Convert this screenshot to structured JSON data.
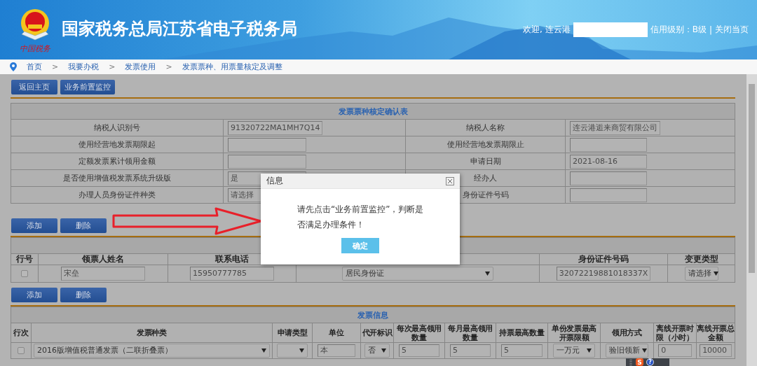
{
  "header": {
    "title": "国家税务总局江苏省电子税务局",
    "emblem_caption": "中国税务",
    "welcome": "欢迎, 连云港",
    "credit": "信用级别：B级",
    "separator": "|",
    "close": "关闭当页"
  },
  "breadcrumb": [
    "首页",
    "我要办税",
    "发票使用",
    "发票票种、用票量核定及调整"
  ],
  "breadcrumb_separator": ">",
  "top_buttons": [
    "返回主页",
    "业务前置监控"
  ],
  "confirm_form": {
    "title": "发票票种核定确认表",
    "rows": [
      {
        "label": "纳税人识别号",
        "value": "91320722MA1MH7Q14",
        "label_2": "纳税人名称",
        "value_2": "连云港逅来商贸有限公司"
      },
      {
        "label": "使用经营地发票期限起",
        "label_2": "使用经营地发票期限止"
      },
      {
        "label": "定额发票累计领用金额",
        "label_2": "申请日期",
        "value_2": "2021-08-16"
      },
      {
        "label": "是否使用增值税发票系统升级版",
        "value": "是",
        "label_2": "经办人"
      },
      {
        "label": "办理人员身份证件种类",
        "value": "请选择",
        "label_2": "身份证件号码"
      }
    ]
  },
  "applicant_buttons": [
    "添加",
    "删除"
  ],
  "applicant_table": {
    "columns": [
      {
        "label": "行号"
      },
      {
        "label": "领票人姓名"
      },
      {
        "label": "联系电话"
      },
      {},
      {
        "label": "身份证件号码"
      },
      {
        "label": "变更类型"
      }
    ],
    "rows": [
      {
        "checked": false,
        "name": "宋垒",
        "phone": "15950777785",
        "id_type": "居民身份证",
        "id_number": "32072219881018337X",
        "change_type": "请选择"
      }
    ]
  },
  "invoice_buttons": [
    "添加",
    "删除"
  ],
  "invoice_table": {
    "title": "发票信息",
    "columns": [
      "行次",
      "发票种类",
      "申请类型",
      "单位",
      "代开标识",
      "每次最高领用数量",
      "每月最高领用数量",
      "持票最高数量",
      "单份发票最高开票限额",
      "领用方式",
      "离线开票时限（小时）",
      "离线开票总金额"
    ],
    "rows": [
      {
        "cells": [
          {
            "kind": "checkbox",
            "checked": false
          },
          {
            "kind": "select",
            "value": "2016版增值税普通发票（二联折叠票）"
          },
          {
            "kind": "select"
          },
          {
            "kind": "input",
            "value": "本"
          },
          {
            "kind": "select",
            "value": "否"
          },
          {
            "kind": "input",
            "value": "5"
          },
          {
            "kind": "input",
            "value": "5"
          },
          {
            "kind": "input",
            "value": "5"
          },
          {
            "kind": "select",
            "value": "一万元"
          },
          {
            "kind": "select",
            "value": "验旧领新"
          },
          {
            "kind": "input",
            "value": "0"
          },
          {
            "kind": "input",
            "value": "10000"
          }
        ]
      }
    ]
  },
  "dialog": {
    "title": "信息",
    "message": "请先点击“业务前置监控”，判断是否满足办理条件！",
    "button": "确定"
  },
  "ime_toolbar": {
    "logo": "S",
    "help": "?"
  }
}
